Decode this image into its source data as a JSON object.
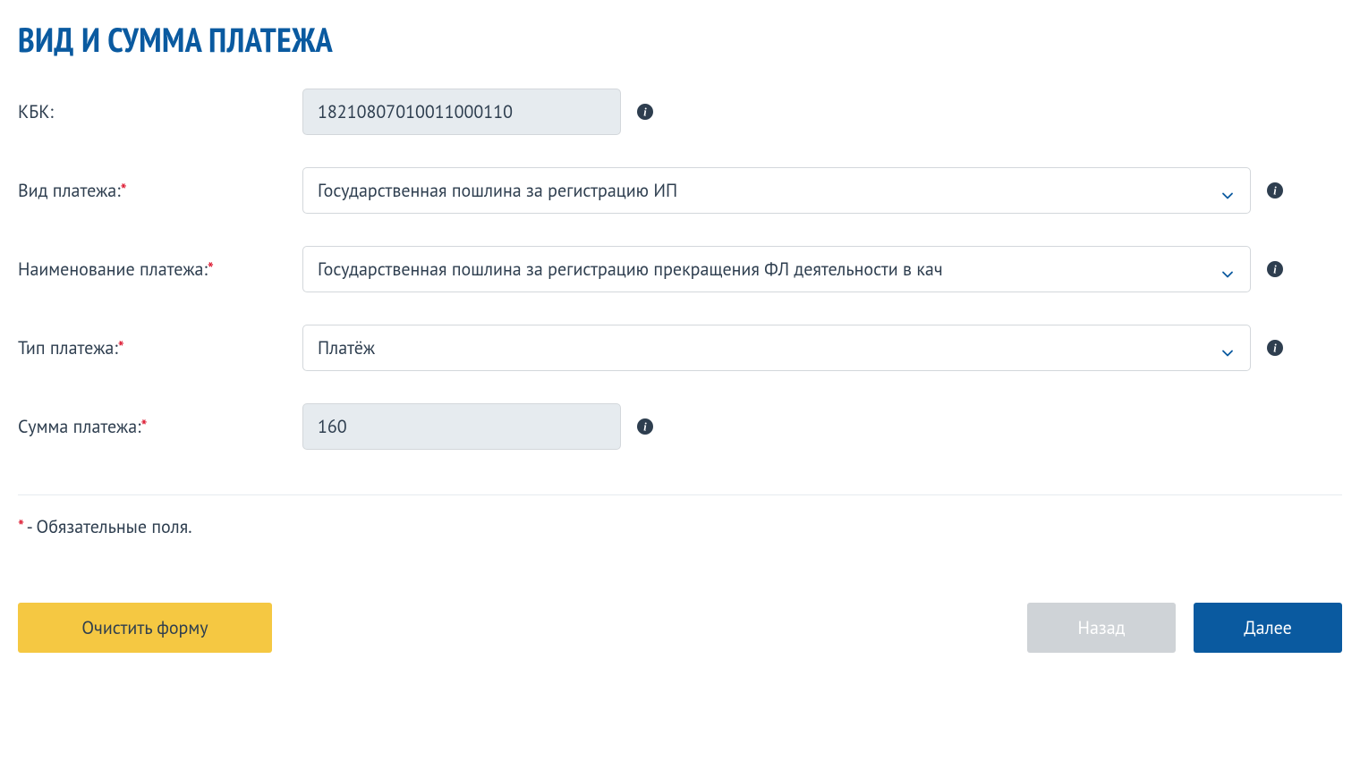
{
  "title": "ВИД И СУММА ПЛАТЕЖА",
  "fields": {
    "kbk": {
      "label": "КБК:",
      "value": "18210807010011000110"
    },
    "payment_kind": {
      "label": "Вид платежа:",
      "value": "Государственная пошлина за регистрацию ИП"
    },
    "payment_name": {
      "label": "Наименование платежа:",
      "value": "Государственная пошлина за регистрацию прекращения ФЛ деятельности в кач"
    },
    "payment_type": {
      "label": "Тип платежа:",
      "value": "Платёж"
    },
    "payment_sum": {
      "label": "Сумма платежа:",
      "value": "160"
    }
  },
  "footnote": {
    "asterisk": "*",
    "text": " - Обязательные поля."
  },
  "buttons": {
    "clear": "Очистить форму",
    "back": "Назад",
    "next": "Далее"
  }
}
